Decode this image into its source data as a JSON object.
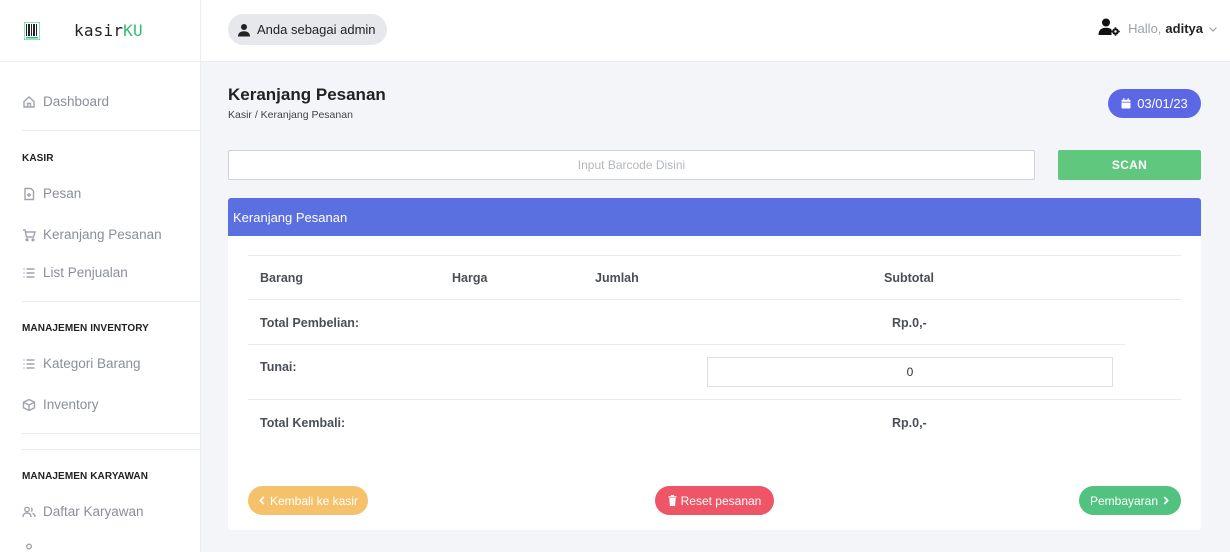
{
  "brand": {
    "name_main": "kasir",
    "name_accent": "KU",
    "logo_icon": "barcode-icon"
  },
  "topbar": {
    "role_label": "Anda sebagai admin",
    "greeting": "Hallo,",
    "username": "aditya"
  },
  "sidebar": {
    "dashboard": "Dashboard",
    "section_kasir": "KASIR",
    "pesan": "Pesan",
    "keranjang": "Keranjang Pesanan",
    "list_penjualan": "List Penjualan",
    "section_inventory": "MANAJEMEN INVENTORY",
    "kategori": "Kategori Barang",
    "inventory": "Inventory",
    "section_karyawan": "MANAJEMEN KARYAWAN",
    "daftar_karyawan": "Daftar Karyawan"
  },
  "page": {
    "title": "Keranjang Pesanan",
    "breadcrumb": "Kasir / Keranjang Pesanan",
    "date": "03/01/23"
  },
  "barcode": {
    "placeholder": "Input Barcode Disini",
    "scan_label": "SCAN"
  },
  "card": {
    "title": "Keranjang Pesanan",
    "columns": [
      "Barang",
      "Harga",
      "Jumlah",
      "Subtotal"
    ],
    "total_pembelian_label": "Total Pembelian:",
    "total_pembelian_value": "Rp.0,-",
    "tunai_label": "Tunai:",
    "tunai_value": "0",
    "total_kembali_label": "Total Kembali:",
    "total_kembali_value": "Rp.0,-"
  },
  "actions": {
    "back_label": "Kembali ke kasir",
    "reset_label": "Reset pesanan",
    "pay_label": "Pembayaran"
  },
  "colors": {
    "primary": "#5b67e5",
    "card_header": "#5b70e0",
    "scan": "#5fc87e",
    "back": "#f5c26b",
    "reset": "#ee5566",
    "pay": "#52c280"
  }
}
